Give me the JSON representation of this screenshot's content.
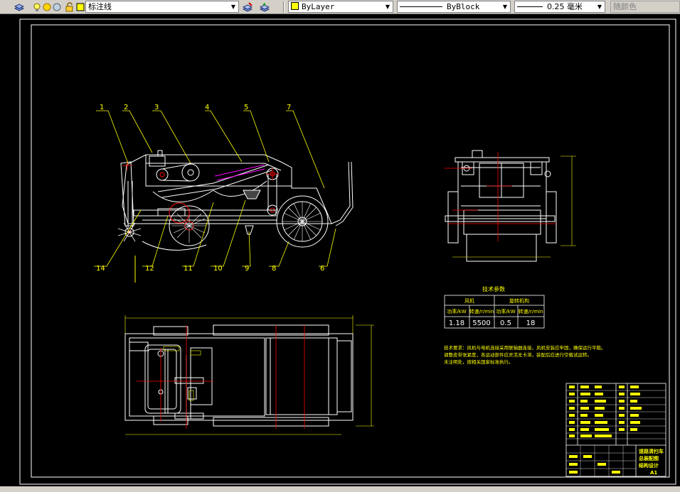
{
  "toolbar": {
    "layer_name": "标注线",
    "color_value": "ByLayer",
    "linetype_value": "ByBlock",
    "lineweight_value": "0.25 毫米",
    "plotstyle_value": "随颜色",
    "icons": [
      "layer-manager-icon",
      "lightbulb-icon",
      "sun-icon",
      "freeze-icon",
      "lock-icon",
      "color-square-icon",
      "make-current-icon",
      "layer-previous-icon"
    ]
  },
  "drawing": {
    "balloons": {
      "b1": "1",
      "b2": "2",
      "b3": "3",
      "b4": "4",
      "b5": "5",
      "b7": "7",
      "b14": "14",
      "b12": "12",
      "b11": "11",
      "b10": "10",
      "b9": "9",
      "b8": "8",
      "b6": "6"
    },
    "table_title": "技术参数",
    "table_headers": [
      "风机",
      "旋转机构"
    ],
    "table_subheaders": [
      "功率/kW",
      "转速/r/min",
      "功率/kW",
      "转速/r/min"
    ],
    "table_values": [
      "1.18",
      "5500",
      "0.5",
      "18"
    ],
    "tech_note_lines": [
      "技术要求：风机与电机连接采用联轴器连接，风机安装应牢固，确保运行平稳。",
      "调整皮带张紧度，各运动部件应灵活无卡滞，装配后应进行空载试运转。",
      "未注明处，按相关国家标准执行。"
    ],
    "title_block": {
      "name_line1": "道路清扫车",
      "name_line2": "总装配图",
      "name_line3": "结构设计",
      "sheet": "A1"
    }
  },
  "colors": {
    "toolbar_bg": "#d4d0c8",
    "canvas_bg": "#000000",
    "line_white": "#ffffff",
    "dimension_yellow": "#ffff00",
    "center_red": "#ff0000",
    "accent_magenta": "#ff00ff"
  }
}
